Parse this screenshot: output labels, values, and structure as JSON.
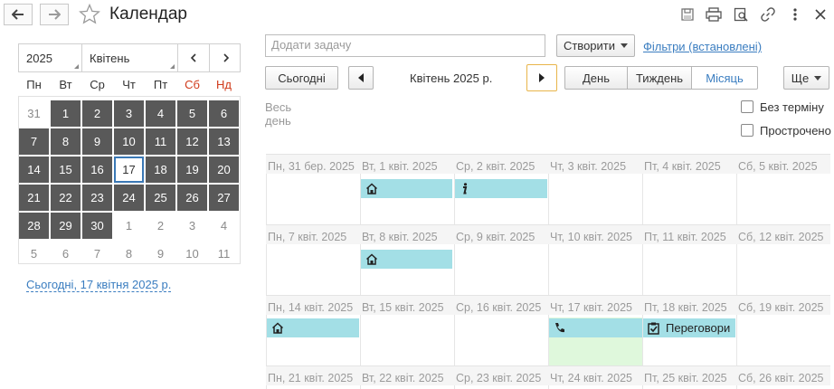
{
  "window": {
    "title": "Календар"
  },
  "mini_calendar": {
    "year": "2025",
    "month": "Квітень",
    "weekdays": [
      "Пн",
      "Вт",
      "Ср",
      "Чт",
      "Пт",
      "Сб",
      "Нд"
    ],
    "weekend_color": "#d03a1a",
    "days": [
      [
        "31",
        "1",
        "2",
        "3",
        "4",
        "5",
        "6"
      ],
      [
        "7",
        "8",
        "9",
        "10",
        "11",
        "12",
        "13"
      ],
      [
        "14",
        "15",
        "16",
        "17",
        "18",
        "19",
        "20"
      ],
      [
        "21",
        "22",
        "23",
        "24",
        "25",
        "26",
        "27"
      ],
      [
        "28",
        "29",
        "30",
        "1",
        "2",
        "3",
        "4"
      ],
      [
        "5",
        "6",
        "7",
        "8",
        "9",
        "10",
        "11"
      ]
    ],
    "today_link": "Сьогодні, 17 квітня 2025 р."
  },
  "toolbar": {
    "add_task_placeholder": "Додати задачу",
    "create_label": "Створити",
    "filters_link": "Фільтри (встановлені)",
    "today_button": "Сьогодні",
    "period_label": "Квітень 2025 р.",
    "view_day": "День",
    "view_week": "Тиждень",
    "view_month": "Місяць",
    "more_label": "Ще"
  },
  "options": {
    "all_day_label": "Весь день",
    "no_deadline_label": "Без терміну",
    "overdue_label": "Прострочено"
  },
  "weeks": [
    [
      "Пн, 31 бер. 2025",
      "Вт, 1 квіт. 2025",
      "Ср, 2 квіт. 2025",
      "Чт, 3 квіт. 2025",
      "Пт, 4 квіт. 2025",
      "Сб, 5 квіт. 2025"
    ],
    [
      "Пн, 7 квіт. 2025",
      "Вт, 8 квіт. 2025",
      "Ср, 9 квіт. 2025",
      "Чт, 10 квіт. 2025",
      "Пт, 11 квіт. 2025",
      "Сб, 12 квіт. 2025"
    ],
    [
      "Пн, 14 квіт. 2025",
      "Вт, 15 квіт. 2025",
      "Ср, 16 квіт. 2025",
      "Чт, 17 квіт. 2025",
      "Пт, 18 квіт. 2025",
      "Сб, 19 квіт. 2025"
    ],
    [
      "Пн, 21 квіт. 2025",
      "Вт, 22 квіт. 2025",
      "Ср, 23 квіт. 2025",
      "Чт, 24 квіт. 2025",
      "Пт, 25 квіт. 2025",
      "Сб, 26 квіт. 2025"
    ]
  ],
  "events": {
    "negotiations_label": "Переговори"
  },
  "colors": {
    "event_bg": "#a3dfe6",
    "today_bg": "#dff8dc",
    "accent": "#3a7dc0",
    "mini_day_bg": "#595959"
  }
}
